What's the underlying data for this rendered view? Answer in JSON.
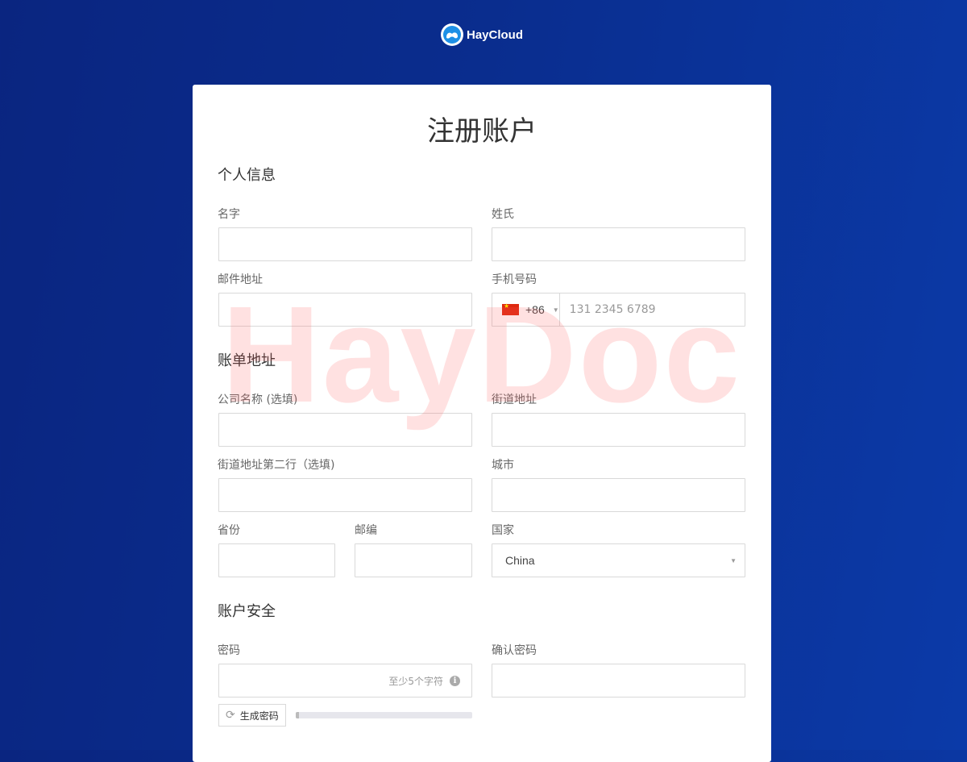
{
  "brand": {
    "name": "HayCloud"
  },
  "form": {
    "title": "注册账户",
    "sections": {
      "personal": "个人信息",
      "billing": "账单地址",
      "security": "账户安全"
    },
    "fields": {
      "first_name": {
        "label": "名字",
        "value": ""
      },
      "last_name": {
        "label": "姓氏",
        "value": ""
      },
      "email": {
        "label": "邮件地址",
        "value": ""
      },
      "phone": {
        "label": "手机号码",
        "country_code": "+86",
        "placeholder": "131 2345 6789",
        "value": ""
      },
      "company": {
        "label": "公司名称 (选填)",
        "value": ""
      },
      "street": {
        "label": "街道地址",
        "value": ""
      },
      "street2": {
        "label": "街道地址第二行（选填)",
        "value": ""
      },
      "city": {
        "label": "城市",
        "value": ""
      },
      "state": {
        "label": "省份",
        "value": ""
      },
      "zip": {
        "label": "邮编",
        "value": ""
      },
      "country": {
        "label": "国家",
        "value": "China"
      },
      "password": {
        "label": "密码",
        "hint": "至少5个字符",
        "value": ""
      },
      "confirm_password": {
        "label": "确认密码",
        "value": ""
      }
    },
    "generate_password_label": "生成密码",
    "password_strength": 0.02
  },
  "watermark": "HayDoc",
  "colors": {
    "accent": "#0b3aa8",
    "watermark": "#ff5a5a"
  },
  "icons": {
    "logo": "haycloud-logo-icon",
    "refresh": "refresh-icon",
    "info": "info-icon",
    "flag": "china-flag-icon",
    "caret": "caret-down-icon"
  }
}
